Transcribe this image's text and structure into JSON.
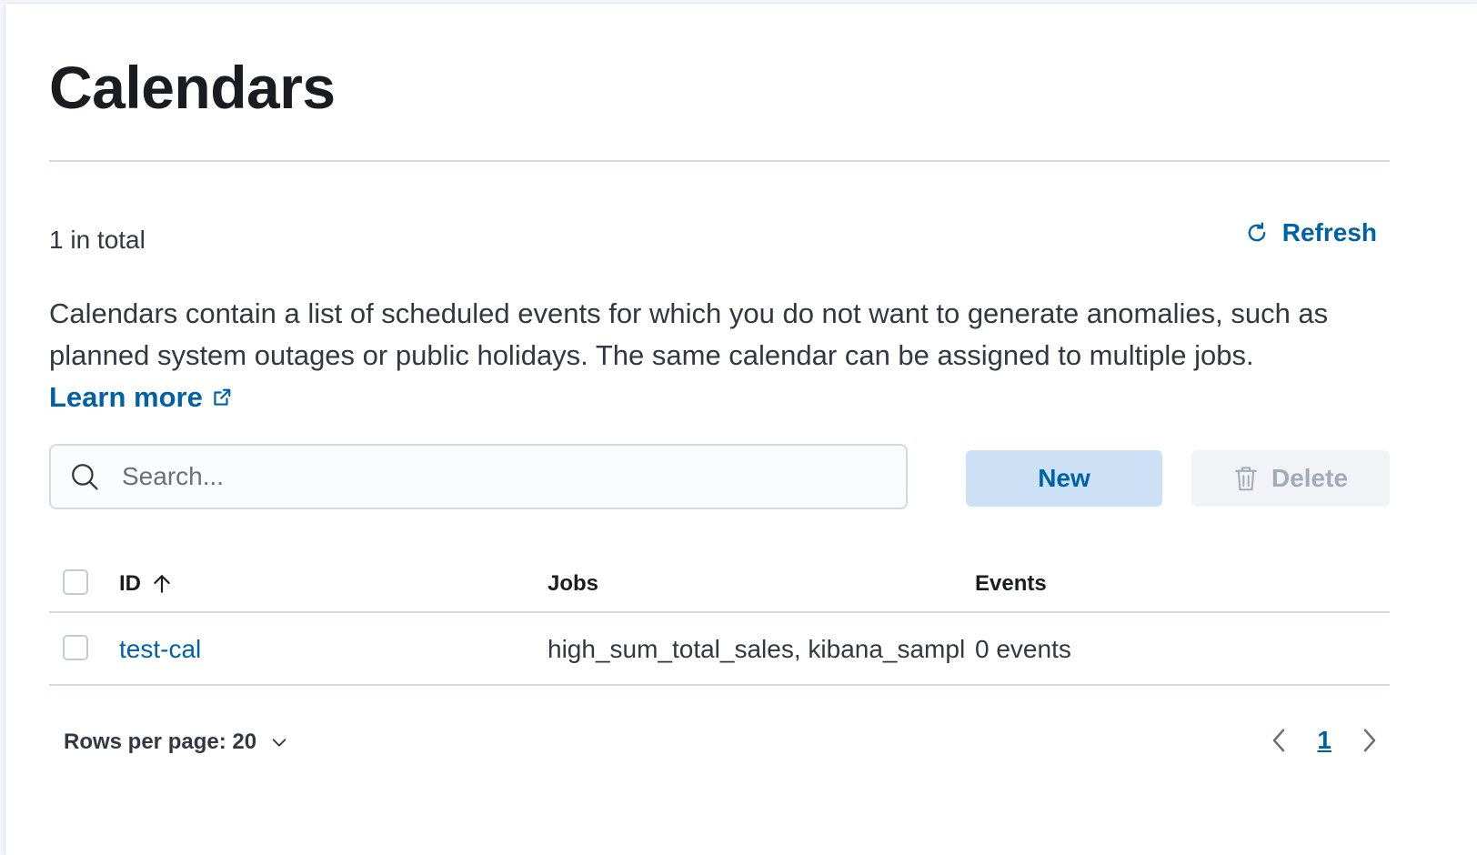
{
  "header": {
    "title": "Calendars"
  },
  "summary": {
    "total_text": "1 in total",
    "refresh_label": "Refresh"
  },
  "description": {
    "text": "Calendars contain a list of scheduled events for which you do not want to generate anomalies, such as planned system outages or public holidays. The same calendar can be assigned to multiple jobs.",
    "learn_more_label": "Learn more"
  },
  "toolbar": {
    "search_placeholder": "Search...",
    "search_value": "",
    "new_label": "New",
    "delete_label": "Delete"
  },
  "table": {
    "columns": {
      "id": "ID",
      "jobs": "Jobs",
      "events": "Events"
    },
    "sort": {
      "column": "ID",
      "direction": "ascending",
      "icon": "arrow-up-icon"
    },
    "rows": [
      {
        "id": "test-cal",
        "jobs": "high_sum_total_sales, kibana_sampl",
        "events": "0 events",
        "selected": false
      }
    ]
  },
  "pagination": {
    "rows_per_page_label": "Rows per page: 20",
    "current_page": "1"
  },
  "colors": {
    "link": "#0061a6",
    "primary_button_bg": "#cce1f5",
    "disabled_button_bg": "#f1f3f6",
    "disabled_text": "#a2abba",
    "border": "#d3dae6",
    "title": "#1a1c21",
    "text": "#343741"
  },
  "icons": {
    "refresh": "refresh-icon",
    "external_link": "external-link-icon",
    "search": "search-icon",
    "delete": "trash-icon",
    "rows_per_page": "chevron-down-icon",
    "prev_page": "chevron-left-icon",
    "next_page": "chevron-right-icon"
  }
}
